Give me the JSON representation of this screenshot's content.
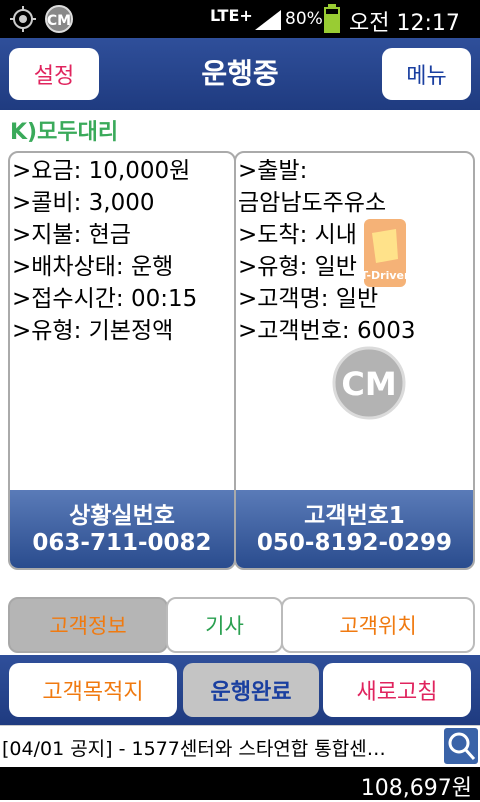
{
  "status_bar": {
    "network": "LTE+",
    "battery": "80%",
    "time": "오전 12:17"
  },
  "header": {
    "settings_label": "설정",
    "title": "운행중",
    "menu_label": "메뉴"
  },
  "company": "K)모두대리",
  "left_panel": {
    "lines": [
      ">요금: 10,000원",
      ">콜비: 3,000",
      ">지불: 현금",
      ">배차상태: 운행",
      ">접수시간: 00:15",
      ">유형: 기본정액"
    ],
    "button_label": "상황실번호",
    "button_number": "063-711-0082"
  },
  "right_panel": {
    "lines": [
      ">출발:",
      "금암남도주유소",
      ">도착: 시내",
      ">유형: 일반",
      ">고객명: 일반",
      ">고객번호: 6003"
    ],
    "button_label": "고객번호1",
    "button_number": "050-8192-0299"
  },
  "tabs": [
    {
      "label": "고객정보",
      "selected": true
    },
    {
      "label": "기사",
      "selected": false
    },
    {
      "label": "고객위치",
      "selected": false
    }
  ],
  "bottom_buttons": {
    "destination_label": "고객목적지",
    "complete_label": "운행완료",
    "refresh_label": "새로고침"
  },
  "notice": "[04/01 공지] - 1577센터와 스타연합 통합센…",
  "balance": "108,697원",
  "watermark": "T-Driver",
  "colors": {
    "header_blue": "#2a4a92",
    "company_green": "#3aaa5a",
    "settings_red": "#e0245e",
    "menu_blue": "#1a3fa0",
    "tab_orange": "#f07a10",
    "tab_green": "#2aa050"
  }
}
